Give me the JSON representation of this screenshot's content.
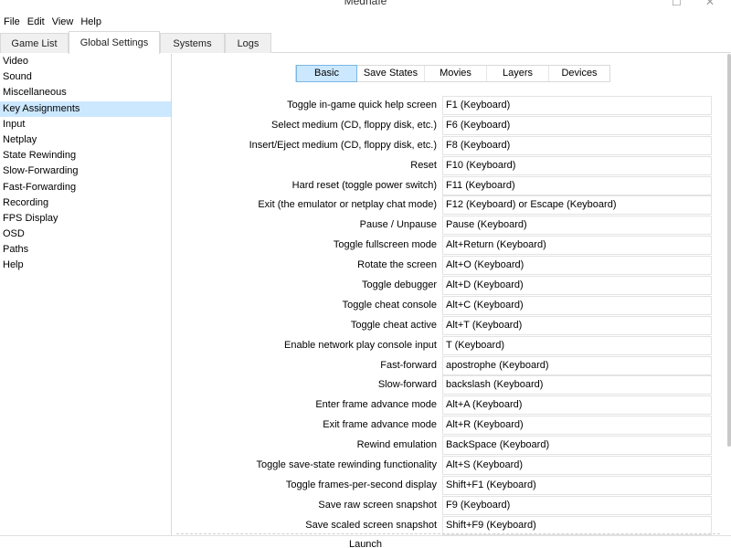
{
  "window": {
    "title": "Mednafe"
  },
  "menu": [
    "File",
    "Edit",
    "View",
    "Help"
  ],
  "tabs": [
    "Game List",
    "Global Settings",
    "Systems",
    "Logs"
  ],
  "active_tab": "Global Settings",
  "sidebar": {
    "items": [
      "Video",
      "Sound",
      "Miscellaneous",
      "Key Assignments",
      "Input",
      "Netplay",
      "State Rewinding",
      "Slow-Forwarding",
      "Fast-Forwarding",
      "Recording",
      "FPS Display",
      "OSD",
      "Paths",
      "Help"
    ],
    "selected": "Key Assignments"
  },
  "subtabs": [
    "Basic",
    "Save States",
    "Movies",
    "Layers",
    "Devices"
  ],
  "active_subtab": "Basic",
  "bindings": [
    {
      "action": "Toggle in-game quick help screen",
      "key": "F1 (Keyboard)"
    },
    {
      "action": "Select medium (CD, floppy disk, etc.)",
      "key": "F6 (Keyboard)"
    },
    {
      "action": "Insert/Eject medium (CD, floppy disk, etc.)",
      "key": "F8 (Keyboard)"
    },
    {
      "action": "Reset",
      "key": "F10 (Keyboard)"
    },
    {
      "action": "Hard reset (toggle power switch)",
      "key": "F11 (Keyboard)"
    },
    {
      "action": "Exit (the emulator or netplay chat mode)",
      "key": "F12 (Keyboard) or Escape (Keyboard)"
    },
    {
      "action": "Pause / Unpause",
      "key": "Pause (Keyboard)"
    },
    {
      "action": "Toggle fullscreen mode",
      "key": "Alt+Return (Keyboard)"
    },
    {
      "action": "Rotate the screen",
      "key": "Alt+O (Keyboard)"
    },
    {
      "action": "Toggle debugger",
      "key": "Alt+D (Keyboard)"
    },
    {
      "action": "Toggle cheat console",
      "key": "Alt+C (Keyboard)"
    },
    {
      "action": "Toggle cheat active",
      "key": "Alt+T (Keyboard)"
    },
    {
      "action": "Enable network play console input",
      "key": "T (Keyboard)"
    },
    {
      "action": "Fast-forward",
      "key": "apostrophe (Keyboard)"
    },
    {
      "action": "Slow-forward",
      "key": "backslash (Keyboard)"
    },
    {
      "action": "Enter frame advance mode",
      "key": "Alt+A (Keyboard)"
    },
    {
      "action": "Exit frame advance mode",
      "key": "Alt+R (Keyboard)"
    },
    {
      "action": "Rewind emulation",
      "key": "BackSpace (Keyboard)"
    },
    {
      "action": "Toggle save-state rewinding functionality",
      "key": "Alt+S (Keyboard)"
    },
    {
      "action": "Toggle frames-per-second display",
      "key": "Shift+F1 (Keyboard)"
    },
    {
      "action": "Save raw screen snapshot",
      "key": "F9 (Keyboard)"
    },
    {
      "action": "Save scaled screen snapshot",
      "key": "Shift+F9 (Keyboard)"
    }
  ],
  "footer": {
    "launch_label": "Launch"
  },
  "colors": {
    "selection": "#cce8ff",
    "border": "#d9d9d9"
  }
}
